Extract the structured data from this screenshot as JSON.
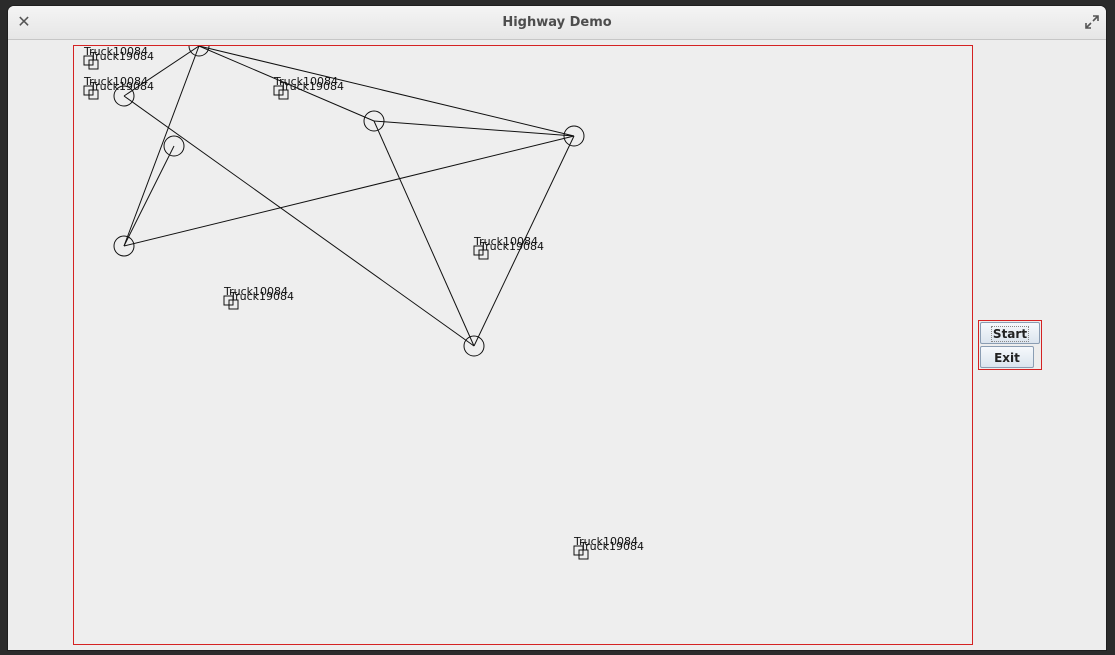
{
  "window": {
    "title": "Highway Demo",
    "close_icon": "close-icon",
    "maximize_icon": "maximize-icon"
  },
  "colors": {
    "panel_border": "#d42222",
    "graph_stroke": "#111111"
  },
  "graph": {
    "nodes": [
      {
        "id": "n1",
        "label": ""
      },
      {
        "id": "n2",
        "label": ""
      },
      {
        "id": "n3",
        "label": ""
      },
      {
        "id": "n4",
        "label": ""
      },
      {
        "id": "n5",
        "label": ""
      },
      {
        "id": "n6",
        "label": ""
      },
      {
        "id": "n7",
        "label": ""
      }
    ]
  },
  "trucks": [
    {
      "label_a": "Truck10084",
      "label_b": "Truck19084"
    },
    {
      "label_a": "Truck10084",
      "label_b": "Truck19084"
    },
    {
      "label_a": "Truck10084",
      "label_b": "Truck19084"
    },
    {
      "label_a": "Truck10084",
      "label_b": "Truck19084"
    },
    {
      "label_a": "Truck10084",
      "label_b": "Truck19084"
    },
    {
      "label_a": "Truck10084",
      "label_b": "Truck19084"
    }
  ],
  "controls": {
    "start_label": "Start",
    "exit_label": "Exit"
  }
}
